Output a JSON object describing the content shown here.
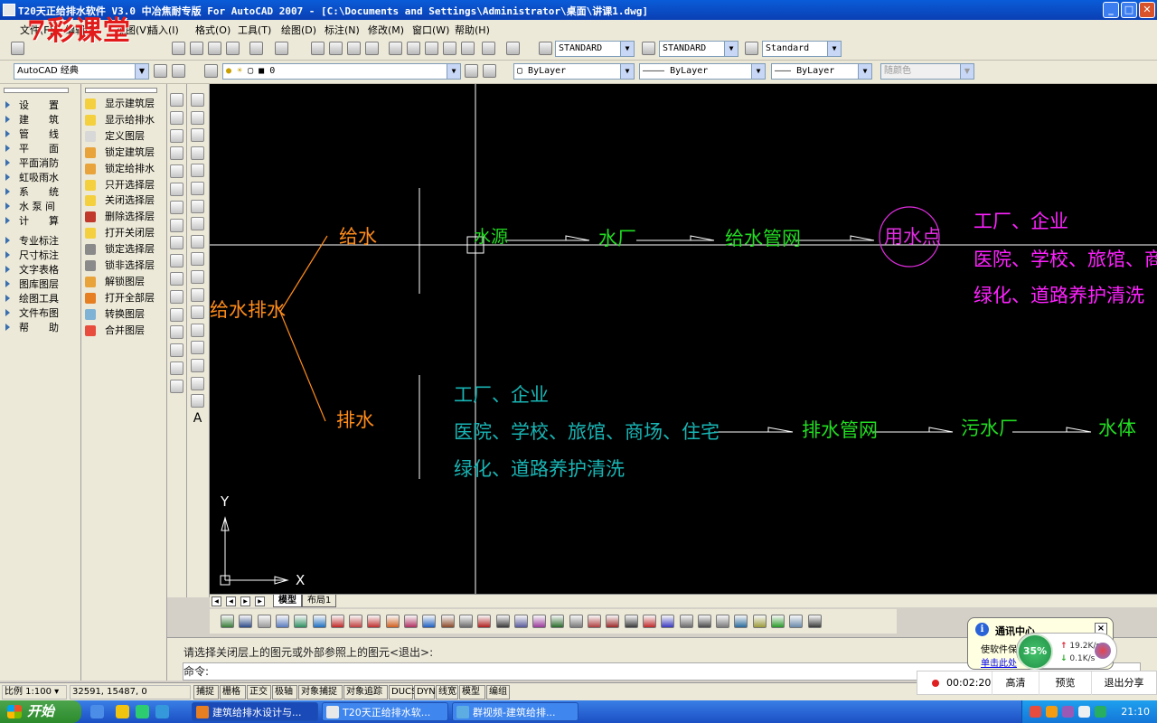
{
  "window": {
    "title": "T20天正给排水软件 V3.0 中冶焦耐专版 For AutoCAD 2007 - [C:\\Documents and Settings\\Administrator\\桌面\\讲课1.dwg]"
  },
  "logo_text": "7彩课堂",
  "menu": [
    {
      "label": "文件(F)"
    },
    {
      "label": "编辑(E)"
    },
    {
      "label": "视图(V)"
    },
    {
      "label": "插入(I)"
    },
    {
      "label": "格式(O)"
    },
    {
      "label": "工具(T)"
    },
    {
      "label": "绘图(D)"
    },
    {
      "label": "标注(N)"
    },
    {
      "label": "修改(M)"
    },
    {
      "label": "窗口(W)"
    },
    {
      "label": "帮助(H)"
    }
  ],
  "toolbar": {
    "text_style": "STANDARD",
    "dim_style": "STANDARD",
    "table_style": "Standard",
    "workspace": "AutoCAD 经典",
    "layer": "0",
    "color": "ByLayer",
    "linetype": "ByLayer",
    "lineweight": "ByLayer",
    "plotstyle": "随颜色"
  },
  "panel1": {
    "items": [
      "设　　置",
      "建　　筑",
      "管　　线",
      "平　　面",
      "平面消防",
      "虹吸雨水",
      "系　　统",
      "水 泵 间",
      "计　　算",
      "专业标注",
      "尺寸标注",
      "文字表格",
      "图库图层",
      "绘图工具",
      "文件布图",
      "帮　　助"
    ]
  },
  "panel2": {
    "items": [
      "显示建筑层",
      "显示给排水",
      "定义图层",
      "锁定建筑层",
      "锁定给排水",
      "只开选择层",
      "关闭选择层",
      "删除选择层",
      "打开关闭层",
      "锁定选择层",
      "锁非选择层",
      "解锁图层",
      "打开全部层",
      "转换图层",
      "合并图层"
    ]
  },
  "drawing": {
    "colors": {
      "orange": "#ff8c1a",
      "green": "#22dd22",
      "magenta": "#ff22ff",
      "cyan": "#19b5b5",
      "white": "#ffffff",
      "pink_circle": "#e02ee0"
    },
    "root": "给水排水",
    "supply": "给水",
    "drain": "排水",
    "source": "水源",
    "plant": "水厂",
    "supply_network": "给水管网",
    "use_point": "用水点",
    "users_supply": [
      "工厂、企业",
      "医院、学校、旅馆、商场",
      "绿化、道路养护清洗"
    ],
    "users_drain": [
      "工厂、企业",
      "医院、学校、旅馆、商场、住宅",
      "绿化、道路养护清洗"
    ],
    "drain_network": "排水管网",
    "sewage_plant": "污水厂",
    "water_body": "水体",
    "axis_x": "X",
    "axis_y": "Y"
  },
  "tabs": [
    "模型",
    "布局1"
  ],
  "command": {
    "history": "请选择关闭层上的图元或外部参照上的图元<退出>:",
    "prompt": "命令:"
  },
  "status": {
    "scale": "比例 1:100",
    "coords": "32591, 15487, 0",
    "toggles": [
      "捕捉",
      "栅格",
      "正交",
      "极轴",
      "对象捕捉",
      "对象追踪",
      "DUCS",
      "DYN",
      "线宽",
      "模型",
      "编组"
    ]
  },
  "notification": {
    "title": "通讯中心",
    "body": "使软件保",
    "link": "单击此处"
  },
  "netspeed": {
    "percent": "35%",
    "up": "19.2K/s",
    "down": "0.1K/s"
  },
  "recorder": {
    "time": "00:02:20",
    "quality": "高清",
    "preview": "预览",
    "exit": "退出分享"
  },
  "taskbar": {
    "start": "开始",
    "tasks": [
      "建筑给排水设计与...",
      "T20天正给排水软...",
      "群视频-建筑给排..."
    ],
    "clock": "21:10"
  }
}
